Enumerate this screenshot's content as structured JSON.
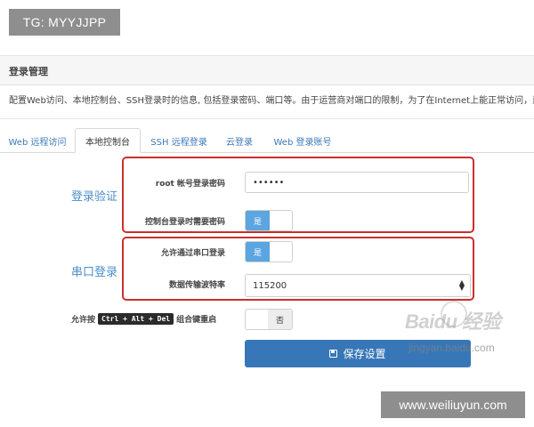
{
  "tg_badge": "TG: MYYJJPP",
  "section_title": "登录管理",
  "description": "配置Web访问、本地控制台、SSH登录时的信息, 包括登录密码、端口等。由于运营商对端口的限制，为了在Internet上能正常访问，建议",
  "tabs": [
    {
      "label": "Web 远程访问",
      "active": false
    },
    {
      "label": "本地控制台",
      "active": true
    },
    {
      "label": "SSH 远程登录",
      "active": false
    },
    {
      "label": "云登录",
      "active": false
    },
    {
      "label": "Web 登录账号",
      "active": false
    }
  ],
  "login_auth": {
    "group_label": "登录验证",
    "root_password_label": "root 帐号登录密码",
    "root_password_value": "••••••",
    "console_password_label": "控制台登录时需要密码",
    "console_password_toggle": "是"
  },
  "serial_login": {
    "group_label": "串口登录",
    "allow_serial_label": "允许通过串口登录",
    "allow_serial_toggle": "是",
    "baud_rate_label": "数据传输波特率",
    "baud_rate_value": "115200"
  },
  "ctrl_alt_del": {
    "prefix": "允许按",
    "keys": "Ctrl + Alt + Del",
    "suffix": "组合键重启",
    "toggle": "否"
  },
  "save_button": "保存设置",
  "watermark": {
    "baidu": "Baidu 经验",
    "jingyan": "jingyan.baidu.com"
  },
  "url_badge": "www.weiliuyun.com",
  "colors": {
    "accent_blue": "#3877b7",
    "toggle_on": "#5ba5e0",
    "highlight_red": "#c9302c",
    "group_label_blue": "#4a8fc8"
  }
}
